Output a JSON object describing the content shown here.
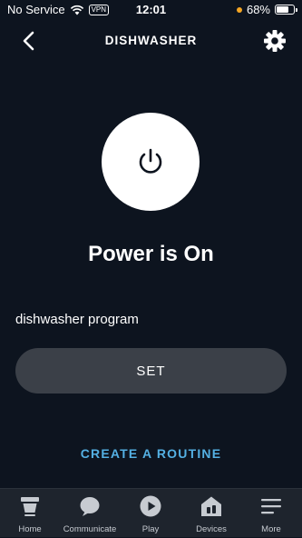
{
  "status_bar": {
    "carrier": "No Service",
    "vpn": "VPN",
    "time": "12:01",
    "battery": "68%",
    "battery_level": 0.68,
    "indicator_color": "#f5a623"
  },
  "header": {
    "title": "DISHWASHER",
    "back_icon": "chevron-left-icon",
    "settings_icon": "gear-icon"
  },
  "main": {
    "power_icon": "power-icon",
    "power_state": "Power is On",
    "program_label": "dishwasher program",
    "set_label": "SET",
    "routine_label": "CREATE A ROUTINE"
  },
  "colors": {
    "background": "#0d141f",
    "button": "#3b4048",
    "accent": "#54b0e3",
    "tab_bar": "#1e242d"
  },
  "tabs": [
    {
      "label": "Home",
      "icon": "home-icon"
    },
    {
      "label": "Communicate",
      "icon": "chat-bubble-icon"
    },
    {
      "label": "Play",
      "icon": "play-icon"
    },
    {
      "label": "Devices",
      "icon": "devices-icon"
    },
    {
      "label": "More",
      "icon": "menu-icon"
    }
  ]
}
